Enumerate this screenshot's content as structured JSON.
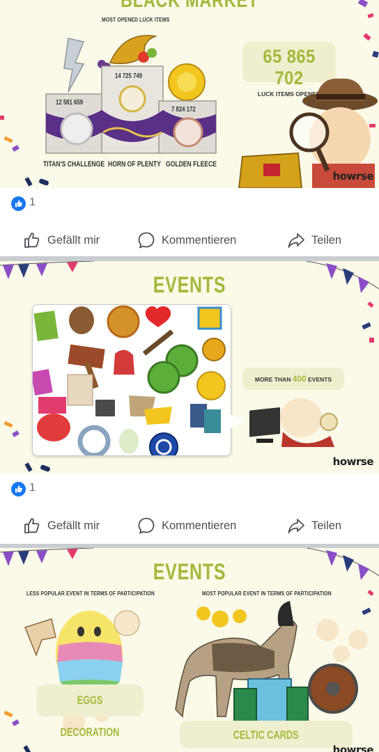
{
  "posts": [
    {
      "panel": {
        "title": "BLACK MARKET",
        "subtitle": "MOST OPENED LUCK ITEMS",
        "podium": [
          {
            "label": "TITAN'S CHALLENGE",
            "count": "12 581 659"
          },
          {
            "label": "HORN OF PLENTY",
            "count": "14 725 749"
          },
          {
            "label": "GOLDEN FLEECE",
            "count": "7 824 172"
          }
        ],
        "total": "65 865 702",
        "total_caption": "LUCK ITEMS OPENED",
        "brand": "howrse"
      },
      "reactions": {
        "count": "1"
      }
    },
    {
      "panel": {
        "title": "EVENTS",
        "more_prefix": "MORE THAN",
        "more_value": "400",
        "more_suffix": "EVENTS",
        "brand": "howrse"
      },
      "reactions": {
        "count": "1"
      }
    },
    {
      "panel": {
        "title": "EVENTS",
        "left_caption": "LESS POPULAR EVENT IN TERMS OF PARTICIPATION",
        "right_caption": "MOST POPULAR EVENT IN TERMS OF PARTICIPATION",
        "left_event": "EGGS DECORATION",
        "right_event": "CELTIC CARDS",
        "brand": "howrse"
      }
    }
  ],
  "actions": {
    "like": "Gefällt mir",
    "comment": "Kommentieren",
    "share": "Teilen"
  },
  "colors": {
    "accent_green": "#a5b83b",
    "panel_bg": "#fbf9e8",
    "facebook_blue": "#1877f2",
    "text_gray": "#4b4f56"
  },
  "icons": [
    "thumbs-up-icon",
    "comment-bubble-icon",
    "share-arrow-icon",
    "like-reaction-icon"
  ]
}
